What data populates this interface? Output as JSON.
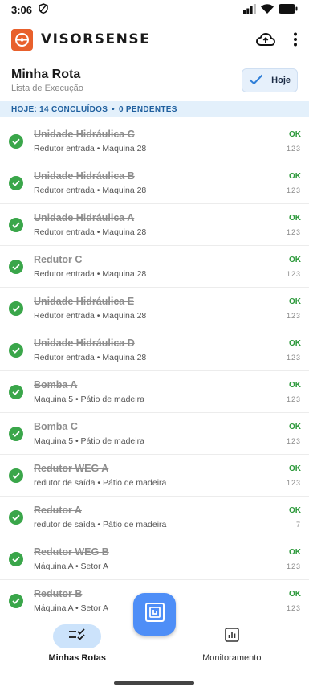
{
  "status_bar": {
    "time": "3:06"
  },
  "app_bar": {
    "brand": "VISORSENSE",
    "icons": [
      "cloud-upload-icon",
      "more-vert-icon"
    ]
  },
  "route": {
    "title": "Minha Rota",
    "subtitle": "Lista de Execução",
    "today_label": "Hoje"
  },
  "summary": {
    "done": "HOJE: 14 CONCLUÍDOS",
    "separator": "•",
    "pending": "0 PENDENTES"
  },
  "items": [
    {
      "name": "Unidade Hidráulica C",
      "sub": "Redutor entrada • Maquina 28",
      "status": "OK",
      "code": "123"
    },
    {
      "name": "Unidade Hidráulica B",
      "sub": "Redutor entrada • Maquina 28",
      "status": "OK",
      "code": "123"
    },
    {
      "name": "Unidade Hidráulica A",
      "sub": "Redutor entrada • Maquina 28",
      "status": "OK",
      "code": "123"
    },
    {
      "name": "Redutor C",
      "sub": "Redutor entrada • Maquina 28",
      "status": "OK",
      "code": "123"
    },
    {
      "name": "Unidade Hidráulica E",
      "sub": "Redutor entrada • Maquina 28",
      "status": "OK",
      "code": "123"
    },
    {
      "name": "Unidade Hidráulica D",
      "sub": "Redutor entrada • Maquina 28",
      "status": "OK",
      "code": "123"
    },
    {
      "name": "Bomba A",
      "sub": "Maquina 5 • Pátio de madeira",
      "status": "OK",
      "code": "123"
    },
    {
      "name": "Bomba C",
      "sub": "Maquina 5 • Pátio de madeira",
      "status": "OK",
      "code": "123"
    },
    {
      "name": "Redutor WEG A",
      "sub": "redutor de saída • Pátio de madeira",
      "status": "OK",
      "code": "123"
    },
    {
      "name": "Redutor A",
      "sub": "redutor de saída • Pátio de madeira",
      "status": "OK",
      "code": "7"
    },
    {
      "name": "Redutor WEG B",
      "sub": "Máquina A • Setor A",
      "status": "OK",
      "code": "123"
    },
    {
      "name": "Redutor B",
      "sub": "Máquina A • Setor A",
      "status": "OK",
      "code": "123"
    }
  ],
  "fab": {
    "icon": "nfc-scan-icon"
  },
  "bottom_nav": [
    {
      "label": "Minhas Rotas",
      "icon": "checklist-icon",
      "active": true
    },
    {
      "label": "Monitoramento",
      "icon": "chart-icon",
      "active": false
    }
  ],
  "colors": {
    "brand": "#e8602c",
    "accent": "#4e8ef7",
    "ok": "#2e9a3c",
    "check": "#3aa64a",
    "summary_bg": "#e3f0fb"
  }
}
